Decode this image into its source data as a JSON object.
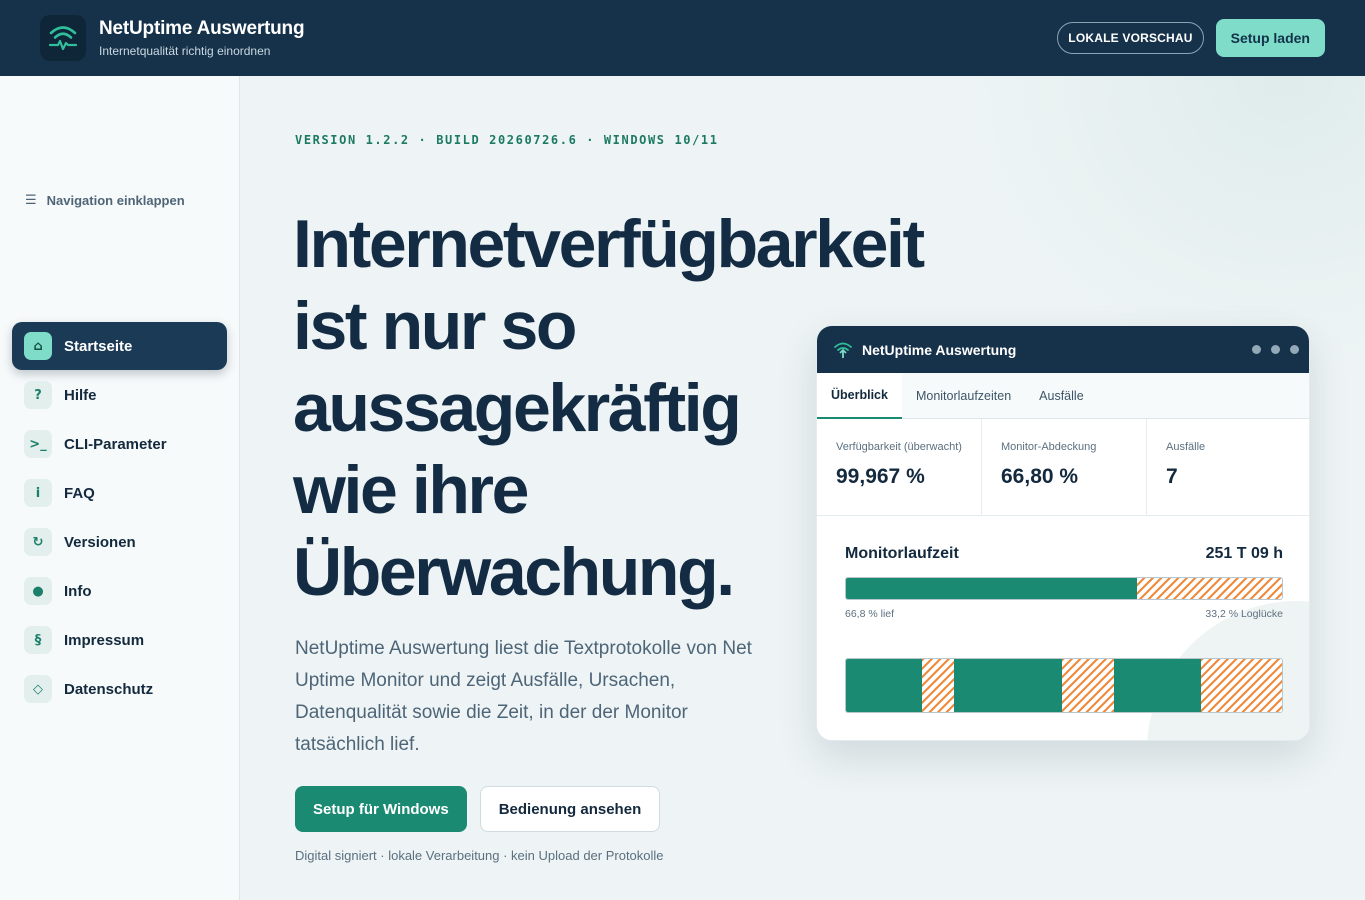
{
  "header": {
    "title": "NetUptime Auswertung",
    "subtitle": "Internetqualität richtig einordnen",
    "preview_label": "LOKALE VORSCHAU",
    "setup_label": "Setup laden"
  },
  "sidebar": {
    "collapse_label": "Navigation einklappen",
    "items": [
      {
        "label": "Startseite",
        "icon": "⌂",
        "icon_name": "home-icon",
        "active": true
      },
      {
        "label": "Hilfe",
        "icon": "?",
        "icon_name": "help-icon"
      },
      {
        "label": "CLI-Parameter",
        "icon": ">_",
        "icon_name": "terminal-icon"
      },
      {
        "label": "FAQ",
        "icon": "i",
        "icon_name": "info-icon"
      },
      {
        "label": "Versionen",
        "icon": "↻",
        "icon_name": "refresh-icon"
      },
      {
        "label": "Info",
        "icon": "●",
        "icon_name": "dot-icon"
      },
      {
        "label": "Impressum",
        "icon": "§",
        "icon_name": "paragraph-icon"
      },
      {
        "label": "Datenschutz",
        "icon": "◇",
        "icon_name": "diamond-icon"
      }
    ]
  },
  "main": {
    "version": "VERSION 1.2.2 · BUILD 20260726.6 · WINDOWS 10/11",
    "headline_lines": [
      "Internetverfügbarkeit",
      "ist nur so",
      "aussagekräftig",
      "wie ihre",
      "Überwachung."
    ],
    "lead": "NetUptime Auswertung liest die Textprotokolle von Net Uptime Monitor und zeigt Ausfälle, Ursachen, Datenqualität sowie die Zeit, in der der Monitor tatsächlich lief.",
    "primary_cta": "Setup für Windows",
    "secondary_cta": "Bedienung ansehen",
    "footnote": "Digital signiert · lokale Verarbeitung · kein Upload der Protokolle"
  },
  "preview": {
    "title": "NetUptime Auswertung",
    "tabs": [
      "Überblick",
      "Monitorlaufzeiten",
      "Ausfälle"
    ],
    "active_tab": 0,
    "stats": [
      {
        "label": "Verfügbarkeit (überwacht)",
        "value": "99,967 %"
      },
      {
        "label": "Monitor-Abdeckung",
        "value": "66,80 %"
      },
      {
        "label": "Ausfälle",
        "value": "7"
      }
    ],
    "runtime": {
      "title": "Monitorlaufzeit",
      "total": "251 T 09 h",
      "run_fraction": 0.668,
      "run_label": "66,8 % lief",
      "gap_label": "33,2 % Loglücke"
    },
    "timeline": [
      {
        "type": "run",
        "share": 0.175
      },
      {
        "type": "gap",
        "share": 0.073
      },
      {
        "type": "run",
        "share": 0.247
      },
      {
        "type": "gap",
        "share": 0.12
      },
      {
        "type": "run",
        "share": 0.2
      },
      {
        "type": "gap",
        "share": 0.185
      }
    ]
  },
  "colors": {
    "navy": "#16324a",
    "accent": "#1a8a72",
    "mint": "#7fdcc8",
    "gap_stripe": "#f08a3c"
  }
}
